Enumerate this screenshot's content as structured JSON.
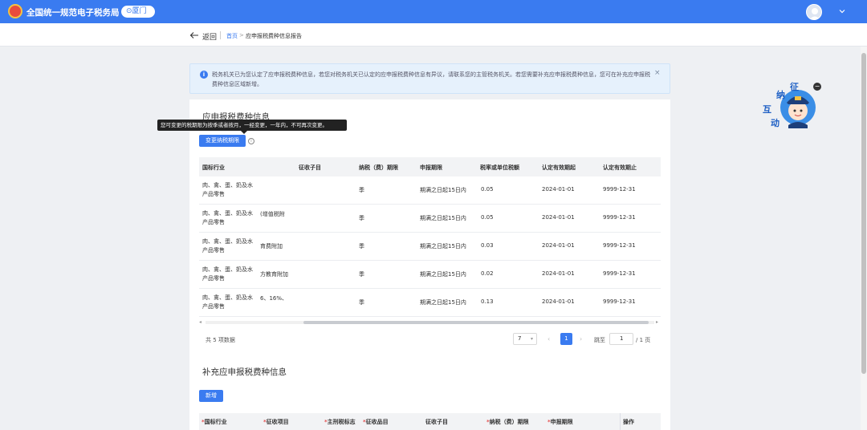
{
  "header": {
    "site_title": "全国统一规范电子税务局",
    "city": "厦门"
  },
  "subbar": {
    "back_label": "返回",
    "breadcrumb_home": "首页",
    "breadcrumb_arrow": ">",
    "breadcrumb_current": "应申报税费种信息报告"
  },
  "alert": {
    "text": "税务机关已为您认定了应申报税费种信息，若您对税务机关已认定的应申报税费种信息有异议，请联系您的主管税务机关。若您需要补充应申报税费种信息，您可在补充应申报税费种信息区域新增。",
    "close_symbol": "×"
  },
  "section1": {
    "title": "应申报税费种信息",
    "tooltip": "您可变更的税期限为按季或者按月，一经变更，一年内，不可再次变更。",
    "change_button": "变更纳税期限",
    "columns": [
      "国标行业",
      "征收子目",
      "纳税（费）期限",
      "申报期限",
      "税率或单位税额",
      "认定有效期起",
      "认定有效期止"
    ],
    "rows": [
      {
        "industry": "肉、禽、蛋、奶及水产品零售",
        "subitem": "",
        "period": "季",
        "deadline": "期满之日起15日内",
        "rate": "0.05",
        "start": "2024-01-01",
        "end": "9999-12-31"
      },
      {
        "industry": "肉、禽、蛋、奶及水产品零售",
        "subitem": "(增值税附",
        "period": "季",
        "deadline": "期满之日起15日内",
        "rate": "0.05",
        "start": "2024-01-01",
        "end": "9999-12-31"
      },
      {
        "industry": "肉、禽、蛋、奶及水产品零售",
        "subitem": "育费附加",
        "period": "季",
        "deadline": "期满之日起15日内",
        "rate": "0.03",
        "start": "2024-01-01",
        "end": "9999-12-31"
      },
      {
        "industry": "肉、禽、蛋、奶及水产品零售",
        "subitem": "方教育附加",
        "period": "季",
        "deadline": "期满之日起15日内",
        "rate": "0.02",
        "start": "2024-01-01",
        "end": "9999-12-31"
      },
      {
        "industry": "肉、禽、蛋、奶及水产品零售",
        "subitem": "6、16%、",
        "period": "季",
        "deadline": "期满之日起15日内",
        "rate": "0.13",
        "start": "2024-01-01",
        "end": "9999-12-31"
      }
    ]
  },
  "pagination": {
    "total": "共 5 项数据",
    "page_size": "7",
    "current_page": "1",
    "jump_label": "跳至",
    "jump_value": "1",
    "total_pages": "/ 1 页"
  },
  "section2": {
    "title": "补充应申报税费种信息",
    "add_button": "新增",
    "columns": [
      "国标行业",
      "征收项目",
      "主刑税标志",
      "征收品目",
      "征收子目",
      "纳税（费）期限",
      "申报期限",
      "操作"
    ],
    "required_mark": "*"
  },
  "mascot": {
    "chars": [
      "纳",
      "互",
      "动",
      "征"
    ],
    "close_symbol": "−"
  },
  "colors": {
    "primary": "#3a7bf0",
    "alert_bg": "#e6f1fc",
    "page_bg": "#eef0f3"
  }
}
